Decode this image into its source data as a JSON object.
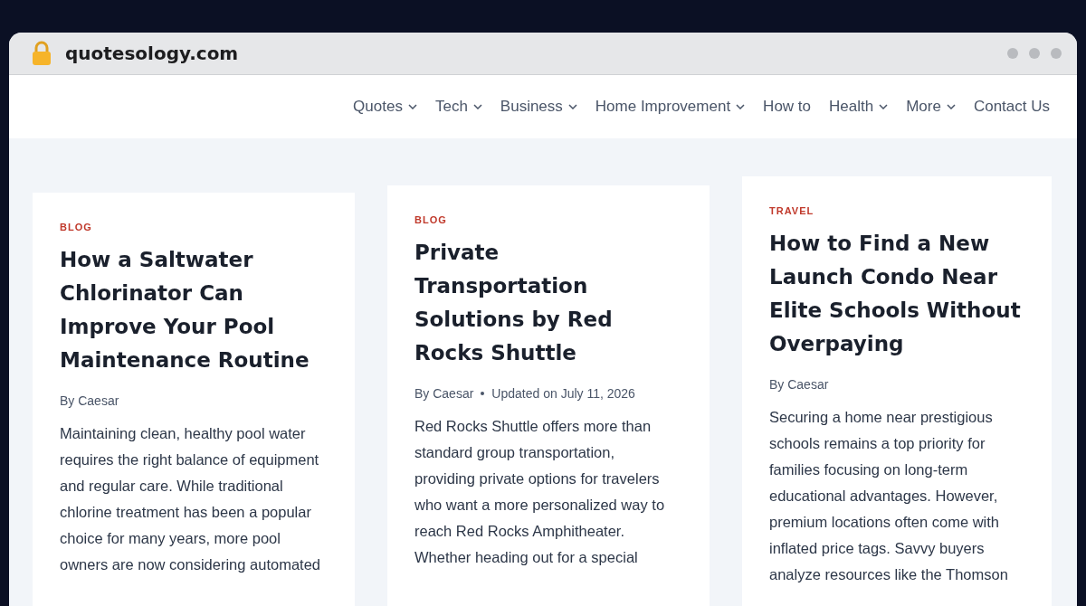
{
  "browser": {
    "address": "quotesology.com"
  },
  "nav": [
    {
      "label": "Quotes",
      "dropdown": true
    },
    {
      "label": "Tech",
      "dropdown": true
    },
    {
      "label": "Business",
      "dropdown": true
    },
    {
      "label": "Home Improvement",
      "dropdown": true
    },
    {
      "label": "How to",
      "dropdown": false
    },
    {
      "label": "Health",
      "dropdown": true
    },
    {
      "label": "More",
      "dropdown": true
    },
    {
      "label": "Contact Us",
      "dropdown": false
    }
  ],
  "posts": [
    {
      "category": "BLOG",
      "title_lines": [
        "How a Saltwater",
        "Chlorinator Can",
        "Improve Your Pool",
        "Maintenance Routine"
      ],
      "author": "By Caesar",
      "excerpt_lines": [
        "Maintaining clean, healthy pool water",
        "requires the right balance of equipment",
        "and regular care. While traditional",
        "chlorine treatment has been a popular",
        "choice for many years, more pool",
        "owners are now considering automated"
      ]
    },
    {
      "category": "BLOG",
      "title_lines": [
        "Private",
        "Transportation",
        "Solutions by Red",
        "Rocks Shuttle"
      ],
      "author": "By Caesar",
      "updated": "Updated on July 11, 2026",
      "excerpt_lines": [
        "Red Rocks Shuttle offers more than",
        "standard group transportation,",
        "providing private options for travelers",
        "who want a more personalized way to",
        "reach Red Rocks Amphitheater.",
        "Whether heading out for a special"
      ]
    },
    {
      "category": "TRAVEL",
      "title_lines": [
        "How to Find a New",
        "Launch Condo Near",
        "Elite Schools Without",
        "Overpaying"
      ],
      "author": "By Caesar",
      "excerpt_lines": [
        "Securing a home near prestigious",
        "schools remains a top priority for",
        "families focusing on long-term",
        "educational advantages. However,",
        "premium locations often come with",
        "inflated price tags. Savvy buyers",
        "analyze resources like the Thomson"
      ]
    }
  ]
}
